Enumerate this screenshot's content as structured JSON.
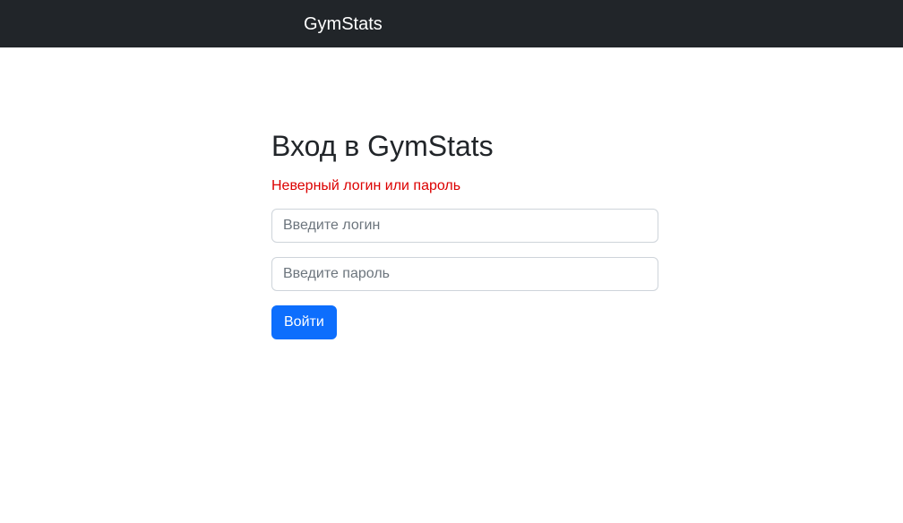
{
  "navbar": {
    "brand": "GymStats",
    "background_color": "#212529"
  },
  "login": {
    "title": "Вход в GymStats",
    "error": "Неверный логин или пароль",
    "error_color": "#dc0000",
    "username": {
      "value": "",
      "placeholder": "Введите логин"
    },
    "password": {
      "value": "",
      "placeholder": "Введите пароль"
    },
    "submit_label": "Войти",
    "accent_color": "#0d6efd"
  }
}
